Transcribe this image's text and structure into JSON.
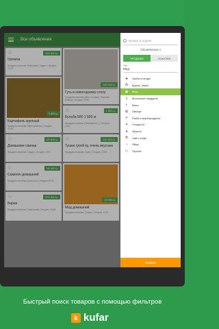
{
  "appbar": {
    "title": "Все объявления"
  },
  "listings": [
    {
      "title": "Гречиха",
      "price": "150 000 р.",
      "meta": "Продукты питания, Молочные, Гродно, Сегодня, 11:34"
    },
    {
      "title": "Гусь в новогоднему столу",
      "price": "299 000 р.",
      "meta": "Продукты питания (Мясо и птица), Минская (Минск), Сегодня, 09:09"
    },
    {
      "title": "Картофель крупный",
      "price": "3 800 р.",
      "meta": "Продукты питания, Минск (Минск), Сегодня, 14:45"
    },
    {
      "title": "Бульба 500 1 500 кг",
      "price": "1 500 р.",
      "meta": "Продукты питания (Мелкопитки...), Сегодня, 13:11"
    },
    {
      "title": "Домашние свиньи",
      "price": "60 000 р.",
      "meta": "Продукты питания, Гродно, Сегодня, 14:11"
    },
    {
      "title": "Тушки гусей ку, очень вкусные",
      "price": "100 000 р.",
      "meta": "Продукты питания, Брест, Сегодня, 13:53"
    },
    {
      "title": "Самогон домашний",
      "price": "80 000 р.",
      "meta": "Продукты питания (Алкоголь), Сегодня, 09:43"
    },
    {
      "title": "Баран",
      "price": "270 000 р.",
      "meta": "Продукты питания, Гомельская, Сегодня, 09:08"
    },
    {
      "title": "Мед домашний",
      "price": "90 000 р.",
      "meta": "Продукты питания, Гродно, Сегодня, 14:21"
    }
  ],
  "filter": {
    "search_placeholder": "Искать в отделе",
    "ads_of": "Объявления о",
    "sell": "ПРОДАЖЕ",
    "buy": "ПОКУПКЕ",
    "type_label": "Тип",
    "type_value": "Мед",
    "categories": [
      {
        "icon": "mushroom-icon",
        "glyph": "♣",
        "label": "Грибы и ягоды"
      },
      {
        "icon": "grain-icon",
        "glyph": "⁂",
        "label": "Крупы, зерно"
      },
      {
        "icon": "honey-icon",
        "glyph": "◉",
        "label": "Мед"
      },
      {
        "icon": "milk-icon",
        "glyph": "▯",
        "label": "Молочные продукты"
      },
      {
        "icon": "meat-icon",
        "glyph": "◐",
        "label": "Мясо"
      },
      {
        "icon": "vegetable-icon",
        "glyph": "✿",
        "label": "Овощи"
      },
      {
        "icon": "fish-icon",
        "glyph": "≻",
        "label": "Рыба и морепродукты"
      },
      {
        "icon": "sweets-icon",
        "glyph": "✦",
        "label": "Сладости"
      },
      {
        "icon": "fruit-icon",
        "glyph": "●",
        "label": "Фрукты"
      },
      {
        "icon": "tea-icon",
        "glyph": "☕",
        "label": "Чай и кофе"
      },
      {
        "icon": "eggs-icon",
        "glyph": "○",
        "label": "Яйца"
      },
      {
        "icon": "other-icon",
        "glyph": "◇",
        "label": "Прочее"
      }
    ],
    "find": "ПОИСК"
  },
  "caption": "Быстрый поиск товаров с помощью фильтров",
  "brand": "kufar"
}
